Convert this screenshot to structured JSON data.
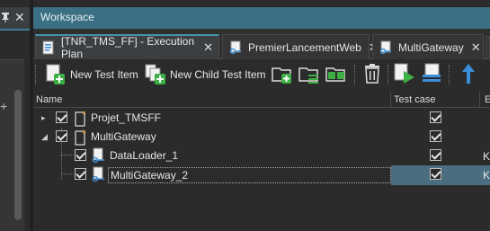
{
  "left_panel": {
    "pin_icon": "pin-icon",
    "close_icon": "close-icon",
    "plus_glyph": "+"
  },
  "workspace": {
    "title": "Workspace"
  },
  "tabs": [
    {
      "label": "[TNR_TMS_FF] - Execution Plan",
      "icon": "execution-plan-icon",
      "active": true
    },
    {
      "label": "PremierLancementWeb",
      "icon": "key-test-icon",
      "active": false
    },
    {
      "label": "MultiGateway",
      "icon": "key-test-icon",
      "active": false
    }
  ],
  "toolbar": {
    "new_test_item": "New Test Item",
    "new_child_test_item": "New Child Test Item"
  },
  "table": {
    "headers": {
      "name": "Name",
      "test_case": "Test case",
      "extra": "E"
    },
    "rows": [
      {
        "name": "Projet_TMSFF",
        "level": 0,
        "expander": "▸",
        "checked": true,
        "test_case": true,
        "extra": "",
        "type": "folder-star"
      },
      {
        "name": "MultiGateway",
        "level": 0,
        "expander": "◢",
        "checked": true,
        "test_case": true,
        "extra": "",
        "type": "folder-star"
      },
      {
        "name": "DataLoader_1",
        "level": 1,
        "expander": "",
        "checked": true,
        "test_case": true,
        "extra": "K",
        "type": "test-key"
      },
      {
        "name": "MultiGateway_2",
        "level": 1,
        "expander": "",
        "checked": true,
        "test_case": true,
        "extra": "K",
        "type": "test-key",
        "selected": true
      }
    ]
  },
  "colors": {
    "accent": "#3a6f84",
    "selection": "#4a6d80",
    "green": "#3cb043",
    "blue_arrow": "#3a8fd9"
  }
}
